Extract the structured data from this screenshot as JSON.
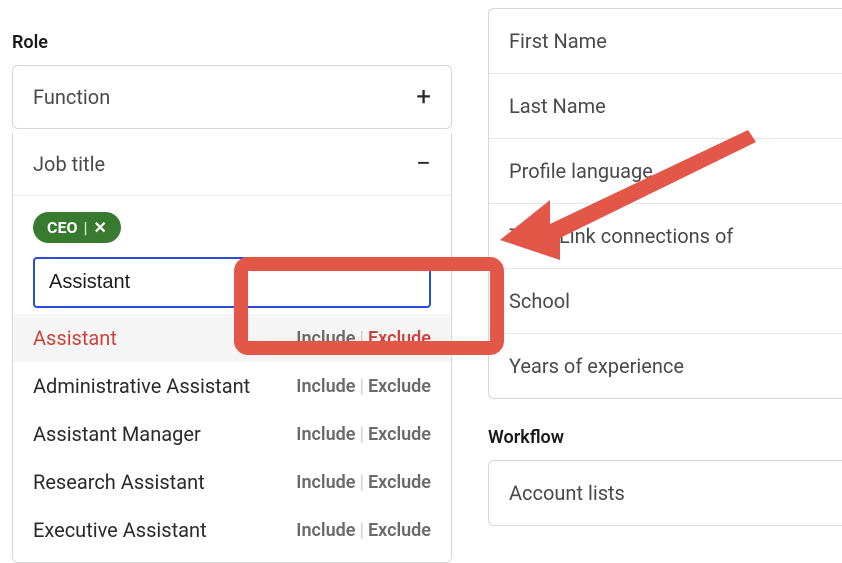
{
  "left": {
    "section_label": "Role",
    "function": {
      "label": "Function"
    },
    "jobtitle": {
      "label": "Job title",
      "chip": "CEO",
      "input_value": "Assistant",
      "suggestions": [
        {
          "title": "Assistant",
          "include": "Include",
          "exclude": "Exclude",
          "highlighted": true,
          "exclude_hl": true
        },
        {
          "title": "Administrative Assistant",
          "include": "Include",
          "exclude": "Exclude",
          "highlighted": false,
          "exclude_hl": false
        },
        {
          "title": "Assistant Manager",
          "include": "Include",
          "exclude": "Exclude",
          "highlighted": false,
          "exclude_hl": false
        },
        {
          "title": "Research Assistant",
          "include": "Include",
          "exclude": "Exclude",
          "highlighted": false,
          "exclude_hl": false
        },
        {
          "title": "Executive Assistant",
          "include": "Include",
          "exclude": "Exclude",
          "highlighted": false,
          "exclude_hl": false
        }
      ]
    }
  },
  "right": {
    "group1": [
      "First Name",
      "Last Name",
      "Profile language",
      "TeamLink connections of",
      "School",
      "Years of experience"
    ],
    "workflow_label": "Workflow",
    "group2": [
      "Account lists"
    ]
  }
}
